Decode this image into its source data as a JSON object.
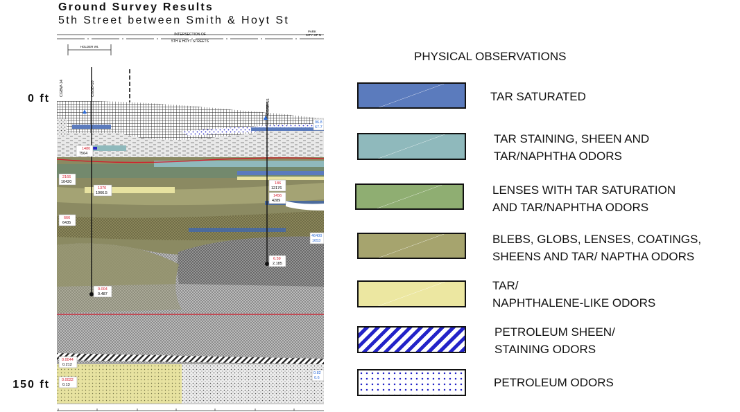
{
  "header": {
    "title": "Ground Survey Results",
    "subtitle": "5th Street between Smith & Hoyt St"
  },
  "depth_markers": [
    {
      "label": "0 ft"
    },
    {
      "label": "150 ft"
    }
  ],
  "cross_section": {
    "top_labels": {
      "intersection": "INTERSECTION OF",
      "intersection2": "5TH & HOYT STREETS",
      "holder": "HOLDER Wt.",
      "park": "PARK",
      "city": "CITY OF N"
    },
    "borings": [
      {
        "id": "CGBW-14"
      },
      {
        "id": "CGSB-10"
      },
      {
        "id": "CGSB-15"
      }
    ],
    "sample_readings": [
      {
        "top": "1480",
        "bottom": "7564"
      },
      {
        "top": "2166",
        "bottom": "10420"
      },
      {
        "top": "1370",
        "bottom": "1066.5"
      },
      {
        "top": "186",
        "bottom": "12176"
      },
      {
        "top": "1456",
        "bottom": "4289"
      },
      {
        "top": "666",
        "bottom": "6435"
      },
      {
        "top": "6.59",
        "bottom": "2,185"
      },
      {
        "top": "0.004",
        "bottom": "0.487"
      },
      {
        "top": "0.0044",
        "bottom": "0.212"
      },
      {
        "top": "0.0022",
        "bottom": "0.13"
      },
      {
        "top": "96.8",
        "bottom": "67.7"
      },
      {
        "top": "46400",
        "bottom": "1653"
      },
      {
        "top": "0.82",
        "bottom": "0.6"
      }
    ]
  },
  "legend": {
    "title": "PHYSICAL OBSERVATIONS",
    "items": [
      {
        "label": "TAR SATURATED",
        "color": "#5b7bbd",
        "pattern": "solid"
      },
      {
        "label": "TAR STAINING, SHEEN AND\nTAR/NAPHTHA ODORS",
        "color": "#8fb9bc",
        "pattern": "solid"
      },
      {
        "label": "LENSES WITH TAR SATURATION\nAND TAR/NAPHTHA ODORS",
        "color": "#8fae72",
        "pattern": "solid"
      },
      {
        "label": "BLEBS, GLOBS, LENSES, COATINGS,\nSHEENS AND TAR/ NAPTHA ODORS",
        "color": "#a6a46e",
        "pattern": "solid"
      },
      {
        "label": "TAR/\nNAPHTHALENE-LIKE ODORS",
        "color": "#ece7a1",
        "pattern": "solid"
      },
      {
        "label": "PETROLEUM SHEEN/\nSTAINING ODORS",
        "color": "#2323c8",
        "pattern": "diagonal-stripes"
      },
      {
        "label": "PETROLEUM  ODORS",
        "color": "#2323c8",
        "pattern": "dots"
      }
    ]
  }
}
